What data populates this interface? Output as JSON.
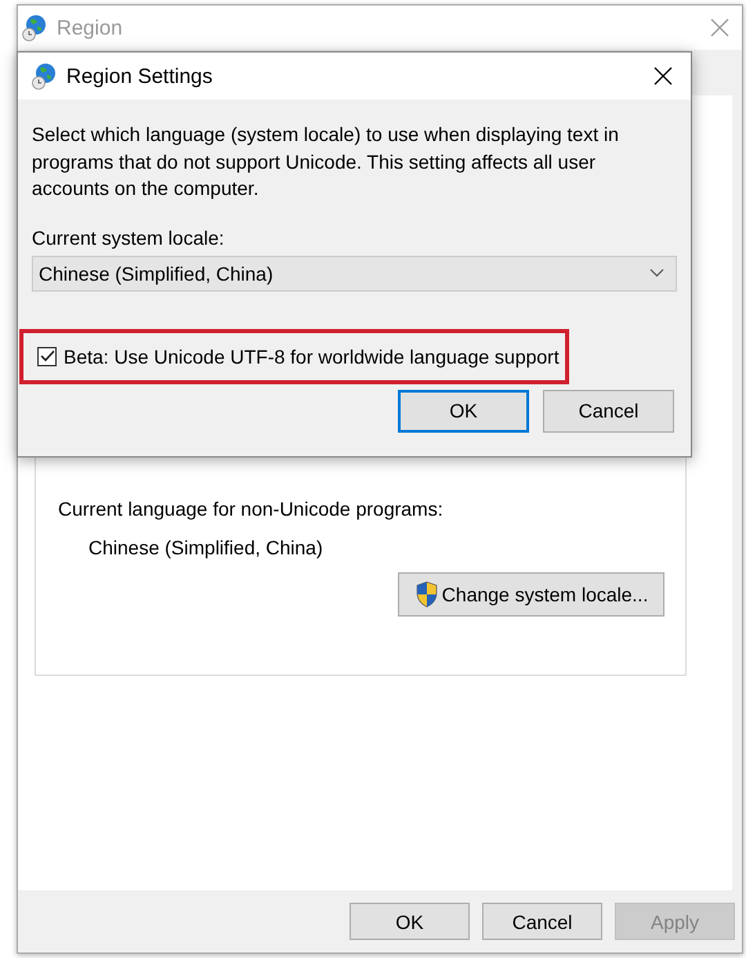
{
  "window": {
    "title": "Region",
    "active": false
  },
  "background_panel": {
    "label": "Current language for non-Unicode programs:",
    "value": "Chinese (Simplified, China)",
    "button": "Change system locale..."
  },
  "buttons": [
    {
      "label": "OK",
      "disabled": false
    },
    {
      "label": "Cancel",
      "disabled": false
    },
    {
      "label": "Apply",
      "disabled": true
    }
  ],
  "dialog": {
    "title": "Region Settings",
    "description": "Select which language (system locale) to use when displaying text in programs that do not support Unicode. This setting affects all user accounts on the computer.",
    "locale_label": "Current system locale:",
    "locale": "Chinese (Simplified, China)",
    "utf8_option": {
      "label": "Beta: Use Unicode UTF-8 for worldwide language support",
      "checked": true,
      "highlighted": true
    },
    "buttons": [
      {
        "label": "OK",
        "default": true
      },
      {
        "label": "Cancel",
        "default": false
      }
    ]
  }
}
